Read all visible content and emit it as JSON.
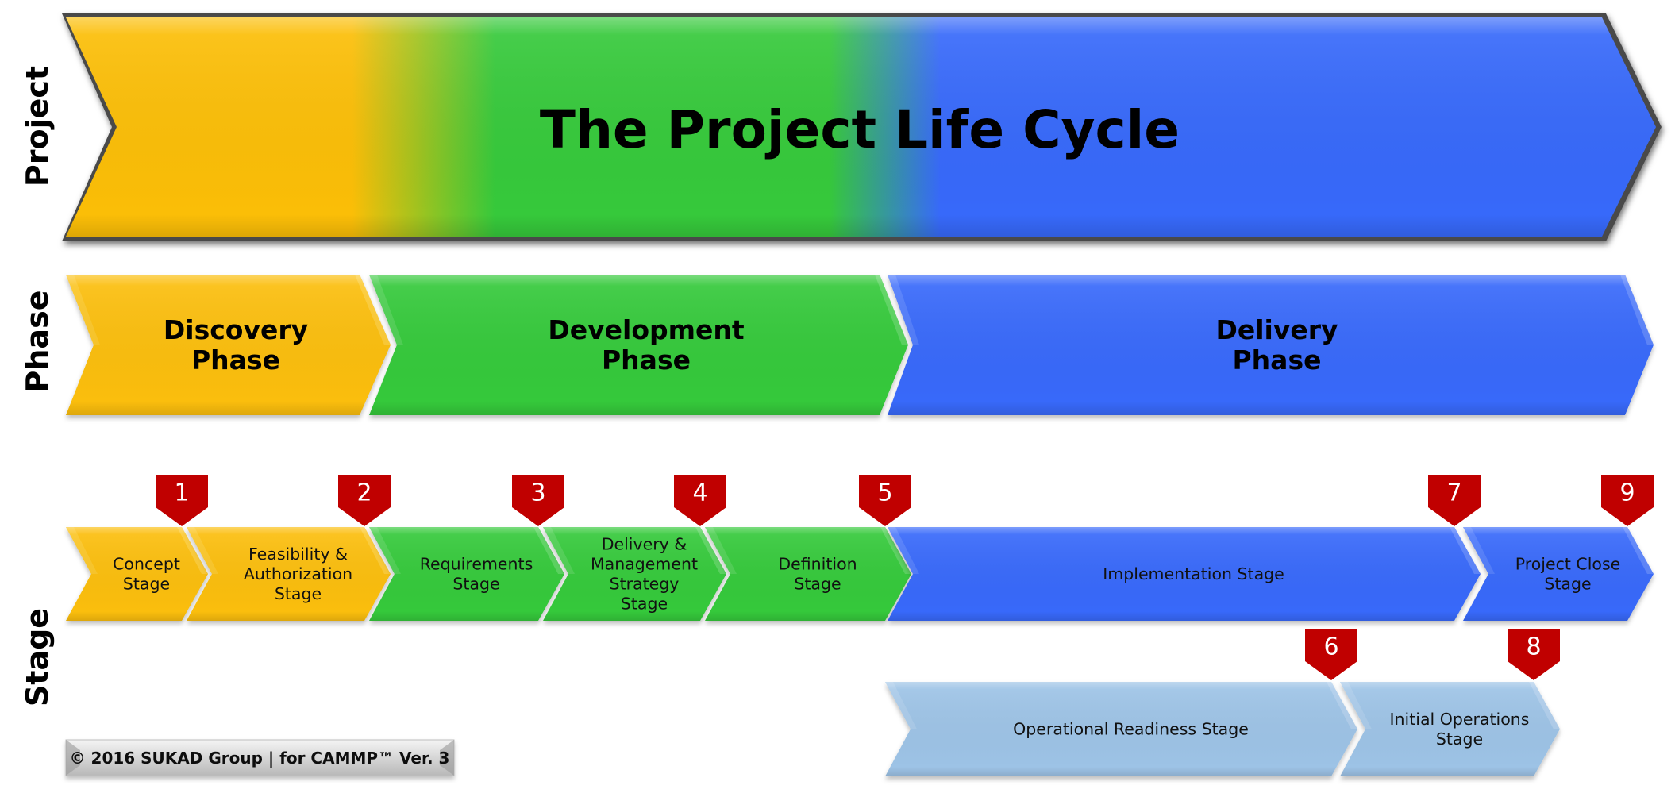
{
  "diagram": {
    "title": "The Project Life Cycle",
    "row_labels": {
      "project": "Project",
      "phase": "Phase",
      "stage": "Stage"
    },
    "colors": {
      "discovery": "#FBBE07",
      "development": "#36C93B",
      "delivery": "#3769FA",
      "operations": "#9DC3E6",
      "milestone": "#C00000",
      "milestone_text": "#FFFFFF",
      "outline": "#4A4A4A"
    },
    "phases": [
      {
        "id": "discovery",
        "lines": [
          "Discovery",
          "Phase"
        ],
        "color_key": "discovery"
      },
      {
        "id": "development",
        "lines": [
          "Development",
          "Phase"
        ],
        "color_key": "development"
      },
      {
        "id": "delivery",
        "lines": [
          "Delivery",
          "Phase"
        ],
        "color_key": "delivery"
      }
    ],
    "stages": [
      {
        "id": "concept",
        "lines": [
          "Concept",
          "Stage"
        ],
        "color_key": "discovery",
        "end_milestone": "1"
      },
      {
        "id": "feasibility-authorization",
        "lines": [
          "Feasibility &",
          "Authorization",
          "Stage"
        ],
        "color_key": "discovery",
        "end_milestone": "2"
      },
      {
        "id": "requirements",
        "lines": [
          "Requirements",
          "Stage"
        ],
        "color_key": "development",
        "end_milestone": "3"
      },
      {
        "id": "delivery-management-strategy",
        "lines": [
          "Delivery &",
          "Management",
          "Strategy",
          "Stage"
        ],
        "color_key": "development",
        "end_milestone": "4"
      },
      {
        "id": "definition",
        "lines": [
          "Definition",
          "Stage"
        ],
        "color_key": "development",
        "end_milestone": "5"
      },
      {
        "id": "implementation",
        "lines": [
          "Implementation Stage"
        ],
        "color_key": "delivery",
        "end_milestone": "7"
      },
      {
        "id": "project-close",
        "lines": [
          "Project Close",
          "Stage"
        ],
        "color_key": "delivery",
        "end_milestone": "9"
      }
    ],
    "operations_stages": [
      {
        "id": "operational-readiness",
        "lines": [
          "Operational Readiness Stage"
        ],
        "color_key": "operations",
        "end_milestone": "6"
      },
      {
        "id": "initial-operations",
        "lines": [
          "Initial Operations",
          "Stage"
        ],
        "color_key": "operations",
        "end_milestone": "8"
      }
    ],
    "milestones": [
      "1",
      "2",
      "3",
      "4",
      "5",
      "6",
      "7",
      "8",
      "9"
    ],
    "copyright": "© 2016 SUKAD Group  |  for CAMMP™ Ver. 3"
  }
}
